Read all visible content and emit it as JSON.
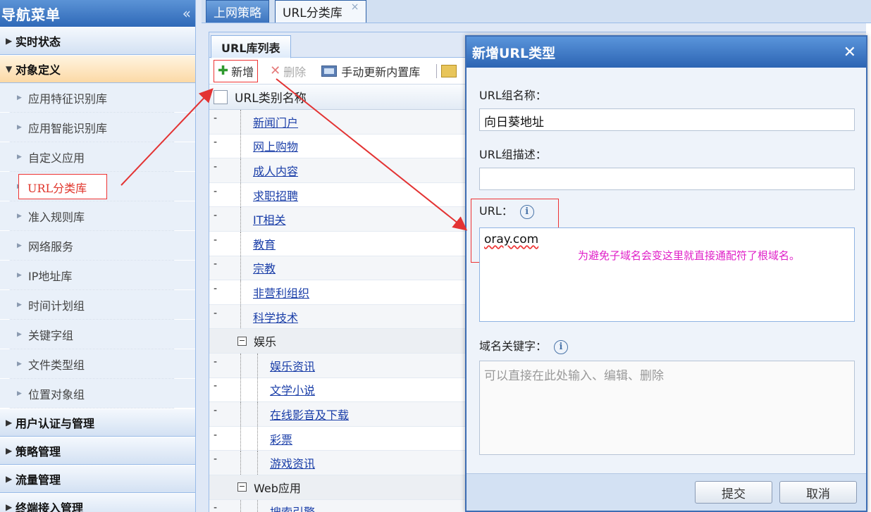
{
  "sidebar": {
    "title": "导航菜单",
    "collapse_icon": "«",
    "groups_top": [
      {
        "label": "实时状态",
        "arrow": "▶"
      },
      {
        "label": "对象定义",
        "arrow": "▼"
      }
    ],
    "items": [
      {
        "label": "应用特征识别库"
      },
      {
        "label": "应用智能识别库"
      },
      {
        "label": "自定义应用"
      },
      {
        "label": "URL分类库"
      },
      {
        "label": "准入规则库"
      },
      {
        "label": "网络服务"
      },
      {
        "label": "IP地址库"
      },
      {
        "label": "时间计划组"
      },
      {
        "label": "关键字组"
      },
      {
        "label": "文件类型组"
      },
      {
        "label": "位置对象组"
      }
    ],
    "groups_bottom": [
      {
        "label": "用户认证与管理",
        "arrow": "▶"
      },
      {
        "label": "策略管理",
        "arrow": "▶"
      },
      {
        "label": "流量管理",
        "arrow": "▶"
      },
      {
        "label": "终端接入管理",
        "arrow": "▶"
      }
    ]
  },
  "top_tabs": [
    {
      "label": "上网策略"
    },
    {
      "label": "URL分类库",
      "close": "×"
    }
  ],
  "panel": {
    "tab": "URL库列表",
    "toolbar": {
      "add": {
        "icon": "✚",
        "label": "新增"
      },
      "delete": {
        "icon": "✕",
        "label": "删除"
      },
      "update": {
        "label": "手动更新内置库"
      }
    },
    "column_header": "URL类别名称",
    "rows": [
      {
        "type": "item",
        "level": 1,
        "label": "新闻门户"
      },
      {
        "type": "item",
        "level": 1,
        "label": "网上购物"
      },
      {
        "type": "item",
        "level": 1,
        "label": "成人内容"
      },
      {
        "type": "item",
        "level": 1,
        "label": "求职招聘"
      },
      {
        "type": "item",
        "level": 1,
        "label": "IT相关"
      },
      {
        "type": "item",
        "level": 1,
        "label": "教育"
      },
      {
        "type": "item",
        "level": 1,
        "label": "宗教"
      },
      {
        "type": "item",
        "level": 1,
        "label": "非营利组织"
      },
      {
        "type": "item",
        "level": 1,
        "label": "科学技术"
      },
      {
        "type": "group",
        "label": "娱乐",
        "icon": "−"
      },
      {
        "type": "item",
        "level": 2,
        "label": "娱乐资讯"
      },
      {
        "type": "item",
        "level": 2,
        "label": "文学小说"
      },
      {
        "type": "item",
        "level": 2,
        "label": "在线影音及下载"
      },
      {
        "type": "item",
        "level": 2,
        "label": "彩票"
      },
      {
        "type": "item",
        "level": 2,
        "label": "游戏资讯"
      },
      {
        "type": "group",
        "label": "Web应用",
        "icon": "−"
      },
      {
        "type": "item",
        "level": 2,
        "label": "搜索引擎"
      }
    ]
  },
  "dialog": {
    "title": "新增URL类型",
    "close_icon": "✕",
    "group_name_label": "URL组名称：",
    "group_name_value": "向日葵地址",
    "group_desc_label": "URL组描述：",
    "group_desc_value": "",
    "url_label": "URL：",
    "url_value": "oray.com",
    "info_icon": "i",
    "annotation": "为避免子域名会变这里就直接通配符了根域名。",
    "keyword_label": "域名关键字：",
    "keyword_placeholder": "可以直接在此处输入、编辑、删除",
    "submit_label": "提交",
    "cancel_label": "取消"
  },
  "colors": {
    "accent_blue": "#2f69b8",
    "highlight_red": "#e33333",
    "annotation_magenta": "#e020c8",
    "link_blue": "#1a3ea8"
  }
}
